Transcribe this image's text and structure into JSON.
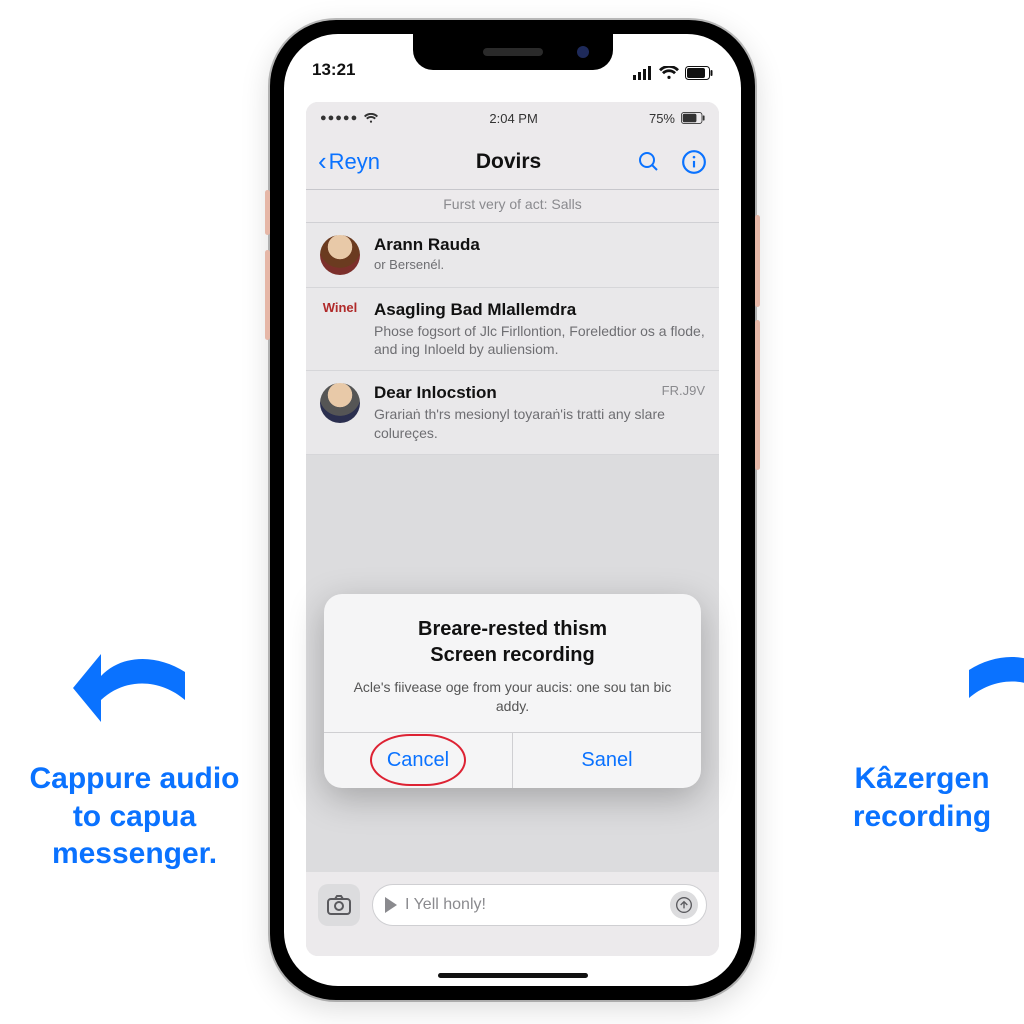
{
  "annot": {
    "left": "Cappure audio to capua messenger.",
    "right": "Kâzergen recording"
  },
  "outer_status": {
    "time": "13:21",
    "signal_icon": "cellular-signal-icon",
    "wifi_icon": "wifi-icon",
    "battery_icon": "battery-icon"
  },
  "inner_status": {
    "dots": "●●●●●",
    "wifi_icon": "wifi-icon",
    "time": "2:04 PM",
    "battery_pct": "75%",
    "battery_icon": "battery-icon"
  },
  "nav": {
    "back_label": "Reyn",
    "title": "Dovirs",
    "search_icon": "search-icon",
    "info_icon": "info-circle-icon"
  },
  "subheader": "Furst very of act: Salls",
  "rows": [
    {
      "title": "Arann Rauda",
      "sub": "or Bersenél.",
      "preview": "",
      "meta": "",
      "avatar": "man1",
      "badge": ""
    },
    {
      "title": "Asagling Bad Mlallemdra",
      "sub": "",
      "preview": "Phose fogsort of Jlc Firllontion, Foreledtior os a flode, and ing Inloeld by auliensiom.",
      "meta": "",
      "avatar": "",
      "badge": "Winel"
    },
    {
      "title": "Dear Inlocstion",
      "sub": "",
      "preview": "Grariaṅ th'rs mesionyl toyaraṅ'is tratti any slare colureçes.",
      "meta": "FR.J9V",
      "avatar": "man2",
      "badge": ""
    }
  ],
  "alert": {
    "title_line1": "Breare-rested thism",
    "title_line2": "Screen recording",
    "message": "Acle's fiivease oge from your aucis: one sou tan bic addy.",
    "cancel": "Cancel",
    "confirm": "Sanel"
  },
  "compose": {
    "camera_icon": "camera-icon",
    "play_icon": "play-icon",
    "placeholder": "I Yell honly!",
    "send_icon": "arrow-up-circle-icon"
  }
}
